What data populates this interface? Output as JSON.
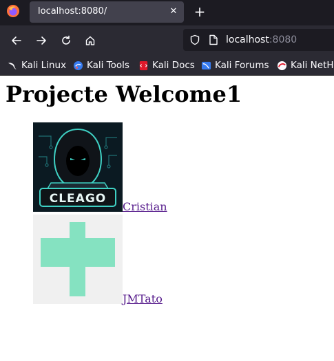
{
  "browser": {
    "tab_title": "localhost:8080/",
    "url_host": "localhost",
    "url_port": ":8080",
    "bookmarks": [
      {
        "label": "Kali Linux",
        "icon": "kali-dragon-icon"
      },
      {
        "label": "Kali Tools",
        "icon": "kali-tools-icon"
      },
      {
        "label": "Kali Docs",
        "icon": "kali-docs-icon"
      },
      {
        "label": "Kali Forums",
        "icon": "kali-forums-icon"
      },
      {
        "label": "Kali NetH",
        "icon": "kali-nethunter-icon"
      }
    ]
  },
  "page": {
    "heading": "Projecte Welcome1",
    "users": [
      {
        "name": "Cristian",
        "avatar_text": "CLEAGO"
      },
      {
        "name": "JMTato"
      }
    ]
  },
  "colors": {
    "link": "#551a8b",
    "avatar2_bg": "#f0f0f0",
    "avatar2_fg": "#85e2c1",
    "avatar1_accent": "#3fd1c4"
  }
}
